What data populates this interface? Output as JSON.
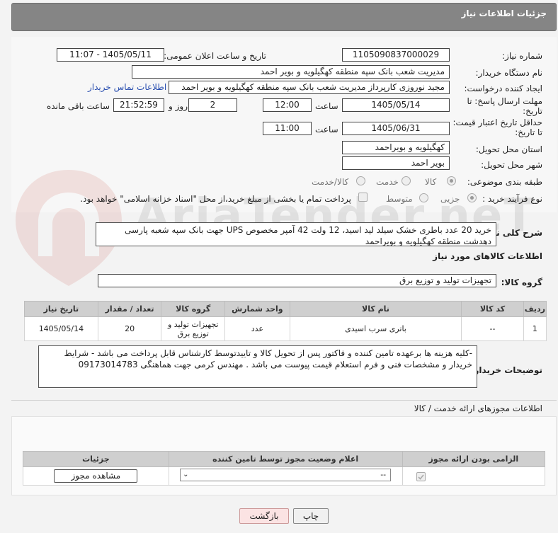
{
  "header": {
    "title": "جزئیات اطلاعات نیاز"
  },
  "form": {
    "need_number_label": "شماره نیاز:",
    "need_number": "1105090837000029",
    "announce_label": "تاریخ و ساعت اعلان عمومی:",
    "announce_value": "1405/05/11 - 11:07",
    "buyer_org_label": "نام دستگاه خریدار:",
    "buyer_org": "مدیریت شعب بانک سپه منطقه کهگیلویه و بویر احمد",
    "requester_label": "ایجاد کننده درخواست:",
    "requester": "مجید نوروزی کارپرداز مدیریت شعب بانک سپه منطقه کهگیلویه و بویر احمد",
    "contact_link": "اطلاعات تماس خریدار",
    "deadline_label_1": "مهلت ارسال پاسخ: تا",
    "deadline_label_2": "تاریخ:",
    "deadline_date": "1405/05/14",
    "time_label": "ساعت",
    "deadline_time": "12:00",
    "days_value": "2",
    "days_label": "روز و",
    "remaining_time": "21:52:59",
    "remaining_label": "ساعت باقی مانده",
    "validity_label_1": "حداقل تاریخ اعتبار قیمت:",
    "validity_label_2": "تا تاریخ:",
    "validity_date": "1405/06/31",
    "validity_time": "11:00",
    "province_label": "استان محل تحویل:",
    "province": "کهگیلویه و بویراحمد",
    "city_label": "شهر محل تحویل:",
    "city": "بویر احمد",
    "category_label": "طبقه بندی موضوعی:",
    "category_options": [
      "کالا",
      "خدمت",
      "کالا/خدمت"
    ],
    "process_label": "نوع فرآیند خرید :",
    "process_options": [
      "جزیی",
      "متوسط"
    ],
    "treasury_note": "پرداخت تمام یا بخشی از مبلغ خرید،از محل \"اسناد خزانه اسلامی\" خواهد بود."
  },
  "description": {
    "label": "شرح کلی نیاز:",
    "text": "خرید 20 عدد باطری خشک سیلد لید اسید، 12 ولت 42 آمپر مخصوص UPS جهت بانک سپه شعبه پارسی دهدشت  منطقه کهگیلویه و بویراحمد"
  },
  "goods": {
    "section_title": "اطلاعات کالاهای مورد نیاز",
    "group_label": "گروه کالا:",
    "group_value": "تجهیزات تولید و توزیع برق",
    "columns": [
      "ردیف",
      "کد کالا",
      "نام کالا",
      "واحد شمارش",
      "گروه کالا",
      "تعداد / مقدار",
      "تاریخ نیاز"
    ],
    "rows": [
      [
        "1",
        "--",
        "باتری سرب اسیدی",
        "عدد",
        "تجهیزات تولید و توزیع برق",
        "20",
        "1405/05/14"
      ]
    ]
  },
  "buyer_notes": {
    "label": "توضیحات خریدار:",
    "text": "-کلیه هزینه ها برعهده تامین کننده و فاکتور پس از تحویل کالا و تاییدتوسط کارشناس قابل پرداخت می باشد -  شرایط خریدار و مشخصات فنی و فرم استعلام قیمت پیوست می باشد . مهندس کرمی جهت هماهنگی 09173014783"
  },
  "permits": {
    "section_title": "اطلاعات مجوزهای ارائه خدمت / کالا",
    "columns": [
      "الزامی بودن ارائه مجوز",
      "اعلام وضعیت مجوز توسط تامین کننده",
      "جزئیات"
    ],
    "select_value": "--",
    "view_button": "مشاهده مجوز"
  },
  "buttons": {
    "print": "چاپ",
    "back": "بازگشت"
  },
  "watermark": "AriaTender.neT"
}
